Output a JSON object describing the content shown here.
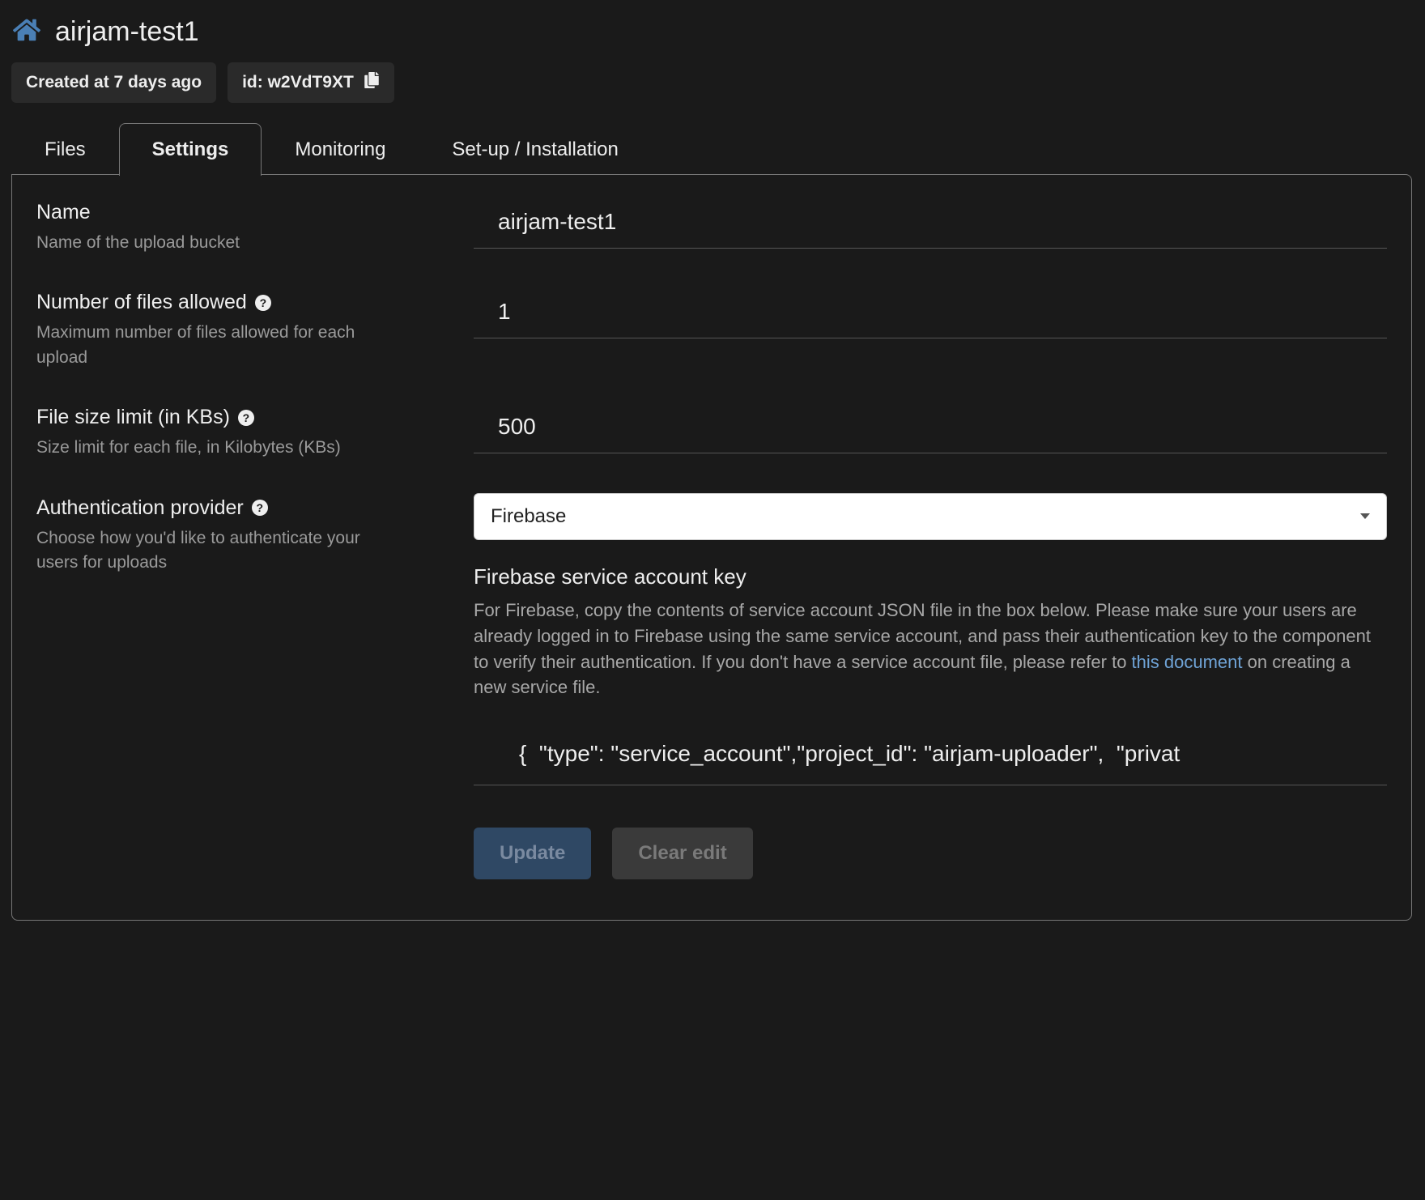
{
  "header": {
    "title": "airjam-test1",
    "created_chip": "Created at 7 days ago",
    "id_chip": "id: w2VdT9XT"
  },
  "tabs": {
    "files": "Files",
    "settings": "Settings",
    "monitoring": "Monitoring",
    "setup": "Set-up / Installation"
  },
  "form": {
    "name": {
      "label": "Name",
      "desc": "Name of the upload bucket",
      "value": "airjam-test1"
    },
    "num_files": {
      "label": "Number of files allowed",
      "desc": "Maximum number of files allowed for each upload",
      "value": "1"
    },
    "size_limit": {
      "label": "File size limit (in KBs)",
      "desc": "Size limit for each file, in Kilobytes (KBs)",
      "value": "500"
    },
    "auth": {
      "label": "Authentication provider",
      "desc": "Choose how you'd like to authenticate your users for uploads",
      "selected": "Firebase",
      "sub_heading": "Firebase service account key",
      "sub_desc_pre": "For Firebase, copy the contents of service account JSON file in the box below. Please make sure your users are already logged in to Firebase using the same service account, and pass their authentication key to the component to verify their authentication. If you don't have a service account file, please refer to ",
      "sub_desc_link": "this document",
      "sub_desc_post": " on creating a new service file.",
      "key_value": "{  \"type\": \"service_account\",\"project_id\": \"airjam-uploader\",  \"privat"
    },
    "buttons": {
      "update": "Update",
      "clear": "Clear edit"
    }
  }
}
